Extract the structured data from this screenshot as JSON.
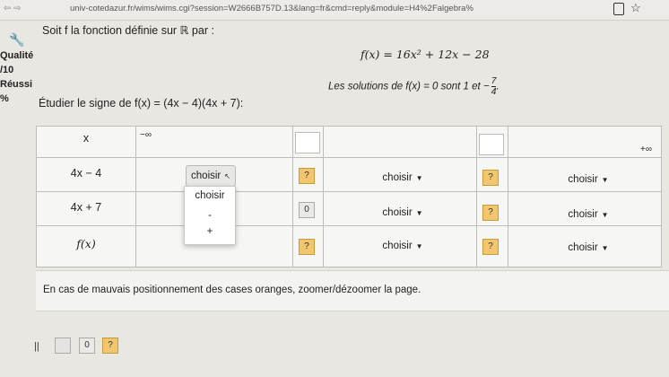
{
  "browser": {
    "nav_label": "⇦ ⇨",
    "url": "univ-cotedazur.fr/wims/wims.cgi?session=W2666B757D.13&lang=fr&cmd=reply&module=H4%2Falgebra%"
  },
  "sidebar": {
    "items": [
      "Qualité",
      "/10",
      "Réussi",
      "%"
    ]
  },
  "intro": "Soit f la fonction définie sur ℝ par :",
  "function_def": "f(x) = 16x² + 12x − 28",
  "solutions_text": "Les solutions de f(x) = 0 sont 1 et −",
  "solutions_fraction": {
    "num": "7",
    "den": "4"
  },
  "task": "Étudier le signe de f(x) = (4x − 4)(4x + 7):",
  "table": {
    "header": {
      "x": "x",
      "minus_inf": "−∞",
      "plus_inf": "+∞"
    },
    "rows": [
      {
        "label": "4x − 4",
        "cells": [
          "choisir",
          "?",
          "choisir",
          "?",
          "choisir"
        ]
      },
      {
        "label": "4x + 7",
        "cells": [
          "choisir",
          "0",
          "choisir",
          "?",
          "choisir"
        ]
      },
      {
        "label": "f(x)",
        "cells": [
          "",
          "?",
          "choisir",
          "?",
          "choisir"
        ]
      }
    ]
  },
  "dropdown_options": [
    "choisir",
    "-",
    "+"
  ],
  "note": "En cas de mauvais positionnement des cases oranges, zoomer/dézoomer la page.",
  "tools": {
    "bars": "||",
    "zero": "0",
    "question": "?"
  }
}
